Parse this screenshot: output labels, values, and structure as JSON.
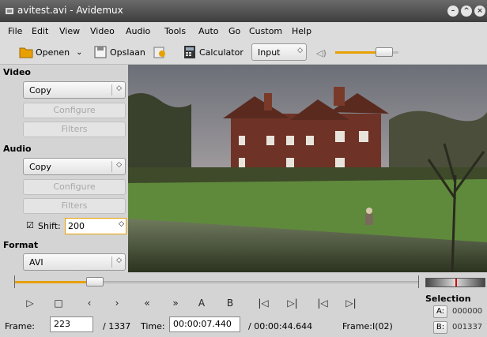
{
  "window": {
    "title": "avitest.avi - Avidemux"
  },
  "menu": [
    "File",
    "Edit",
    "View",
    "Video",
    "Audio",
    "Tools",
    "Auto",
    "Go",
    "Custom",
    "Help"
  ],
  "toolbar": {
    "open_label": "Openen",
    "save_label": "Opslaan",
    "calculator_label": "Calculator",
    "input_select": "Input",
    "volume_fraction": 0.78
  },
  "video": {
    "section_label": "Video",
    "codec": "Copy",
    "configure_label": "Configure",
    "filters_label": "Filters"
  },
  "audio": {
    "section_label": "Audio",
    "codec": "Copy",
    "configure_label": "Configure",
    "filters_label": "Filters",
    "shift_label": "Shift:",
    "shift_value": "200",
    "shift_checked": true
  },
  "format": {
    "section_label": "Format",
    "value": "AVI"
  },
  "navigation": {
    "icons": [
      "play-icon",
      "stop-icon",
      "prev-frame-icon",
      "next-frame-icon",
      "rewind-icon",
      "fast-forward-icon",
      "set-marker-a-icon",
      "set-marker-b-icon",
      "prev-keyframe-icon",
      "next-keyframe-icon",
      "goto-start-icon",
      "goto-end-icon"
    ],
    "glyphs": [
      "▷",
      "□",
      "‹",
      "›",
      "«",
      "»",
      "A",
      "B",
      "|◁",
      "▷|",
      "|◁",
      "▷|"
    ],
    "position_fraction": 0.2
  },
  "status": {
    "frame_label": "Frame:",
    "frame_value": "223",
    "total_frames": "/ 1337",
    "time_label": "Time:",
    "time_value": "00:00:07.440",
    "total_time": "/ 00:00:44.644",
    "frame_type": "Frame:I(02)"
  },
  "selection": {
    "label": "Selection",
    "a_label": "A:",
    "a_value": "000000",
    "b_label": "B:",
    "b_value": "001337"
  },
  "colors": {
    "accent_orange": "#e8a000",
    "titlebar": "#4a4a4a"
  }
}
